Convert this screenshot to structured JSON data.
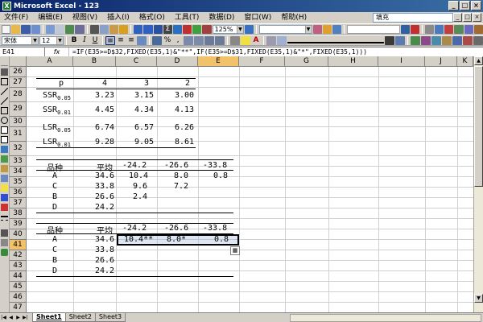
{
  "window": {
    "title": "Microsoft Excel - 123",
    "app_icon": "excel-icon",
    "buttons": [
      "minimize",
      "maximize",
      "close"
    ]
  },
  "menu": {
    "items": [
      "文件(F)",
      "编辑(E)",
      "视图(V)",
      "插入(I)",
      "格式(O)",
      "工具(T)",
      "数据(D)",
      "窗口(W)",
      "帮助(H)"
    ],
    "help_search": "填充"
  },
  "toolbar": {
    "zoom": "125%",
    "font_name": "宋体",
    "font_size": "12"
  },
  "formula_bar": {
    "name_box": "E41",
    "fx_label": "fx",
    "formula": "=IF(E35>=D$32,FIXED(E35,1)&\"**\",IF(E35>=D$31,FIXED(E35,1)&\"*\",FIXED(E35,1)))"
  },
  "columns": [
    "A",
    "B",
    "C",
    "D",
    "E",
    "F",
    "G",
    "H",
    "I",
    "J",
    "K"
  ],
  "rows": [
    "26",
    "27",
    "28",
    "29",
    "30",
    "31",
    "32",
    "33",
    "34",
    "35",
    "36",
    "37",
    "38",
    "39",
    "40",
    "41",
    "42",
    "43",
    "44",
    "45",
    "46",
    "47",
    "48"
  ],
  "selected": {
    "column": "E",
    "row": "41"
  },
  "sheet": {
    "r27": {
      "a": "p",
      "b": "4",
      "c": "3",
      "d": "2"
    },
    "r28": {
      "a_main": "SSR",
      "a_sub": "0.05",
      "b": "3.23",
      "c": "3.15",
      "d": "3.00"
    },
    "r29": {
      "a_main": "SSR",
      "a_sub": "0.01",
      "b": "4.45",
      "c": "4.34",
      "d": "4.13"
    },
    "r31": {
      "a_main": "LSR",
      "a_sub": "0.05",
      "b": "6.74",
      "c": "6.57",
      "d": "6.26"
    },
    "r32": {
      "a_main": "LSR",
      "a_sub": "0.01",
      "b": "9.28",
      "c": "9.05",
      "d": "8.61"
    },
    "r34": {
      "a": "品种",
      "b": "平均",
      "c": "-24.2",
      "d": "-26.6",
      "e": "-33.8"
    },
    "r35": {
      "a": "A",
      "b": "34.6",
      "c": "10.4",
      "d": "8.0",
      "e": "0.8"
    },
    "r36": {
      "a": "C",
      "b": "33.8",
      "c": "9.6",
      "d": "7.2"
    },
    "r37": {
      "a": "B",
      "b": "26.6",
      "c": "2.4"
    },
    "r38": {
      "a": "D",
      "b": "24.2"
    },
    "r40": {
      "a": "品种",
      "b": "平均",
      "c": "-24.2",
      "d": "-26.6",
      "e": "-33.8"
    },
    "r41": {
      "a": "A",
      "b": "34.6",
      "c": "10.4**",
      "d": "8.0*",
      "e": "0.8"
    },
    "r42": {
      "a": "C",
      "b": "33.8"
    },
    "r43": {
      "a": "B",
      "b": "26.6"
    },
    "r44": {
      "a": "D",
      "b": "24.2"
    }
  },
  "tabs": [
    "Sheet1",
    "Sheet2",
    "Sheet3"
  ],
  "active_tab": "Sheet1"
}
